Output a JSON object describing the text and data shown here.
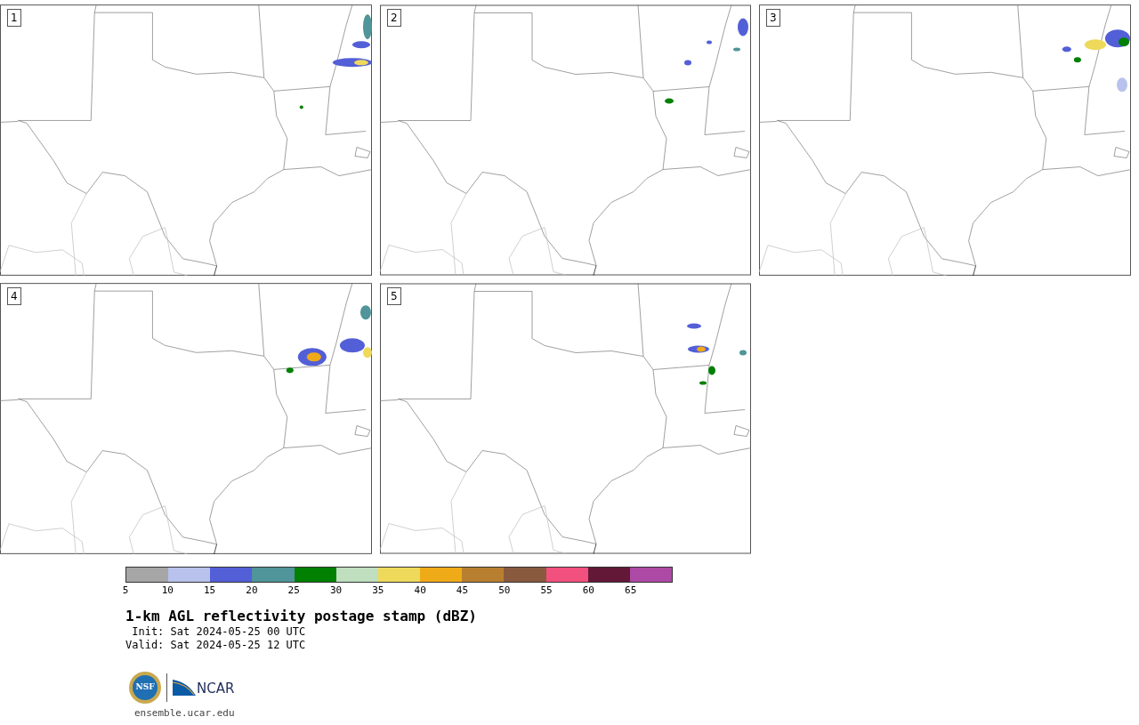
{
  "panels": [
    {
      "label": "1"
    },
    {
      "label": "2"
    },
    {
      "label": "3"
    },
    {
      "label": "4"
    },
    {
      "label": "5"
    }
  ],
  "colorbar": {
    "segments": [
      {
        "color": "#a6a6a6"
      },
      {
        "color": "#b8c2ec"
      },
      {
        "color": "#535fd7"
      },
      {
        "color": "#4f9599"
      },
      {
        "color": "#028002"
      },
      {
        "color": "#bfdfbf"
      },
      {
        "color": "#efd95b"
      },
      {
        "color": "#efaa18"
      },
      {
        "color": "#b97f30"
      },
      {
        "color": "#8a5a3f"
      },
      {
        "color": "#f2507e"
      },
      {
        "color": "#631838"
      },
      {
        "color": "#ad4aa5"
      }
    ],
    "ticks": [
      "5",
      "10",
      "15",
      "20",
      "25",
      "30",
      "35",
      "40",
      "45",
      "50",
      "55",
      "60",
      "65"
    ]
  },
  "title": "1-km AGL reflectivity postage stamp (dBZ)",
  "init": " Init: Sat 2024-05-25 00 UTC",
  "valid": "Valid: Sat 2024-05-25 12 UTC",
  "logos": {
    "nsf": "NSF",
    "ncar": "NCAR"
  },
  "url": "ensemble.ucar.edu"
}
